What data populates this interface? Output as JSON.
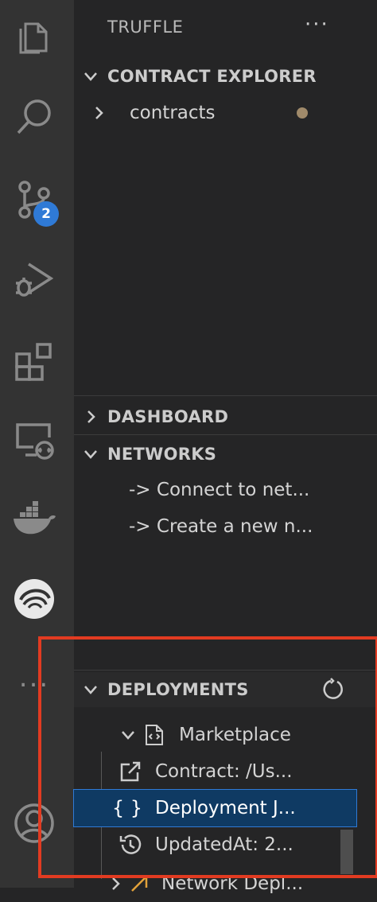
{
  "activity_bar": {
    "icons": [
      "explorer-icon",
      "search-icon",
      "source-control-icon",
      "run-debug-icon",
      "extensions-icon",
      "remote-explorer-icon",
      "docker-icon",
      "truffle-icon",
      "more-icon",
      "account-icon"
    ],
    "source_control_badge": "2",
    "more_label": "..."
  },
  "sidebar": {
    "title": "TRUFFLE",
    "more_label": "···",
    "contract_explorer": {
      "label": "CONTRACT EXPLORER",
      "items": [
        {
          "label": "contracts"
        }
      ]
    },
    "dashboard": {
      "label": "DASHBOARD"
    },
    "networks": {
      "label": "NETWORKS",
      "items": [
        {
          "label": "-> Connect to net..."
        },
        {
          "label": "-> Create a new n..."
        }
      ]
    },
    "deployments": {
      "label": "DEPLOYMENTS",
      "tree": {
        "label": "Marketplace",
        "children": [
          {
            "label": "Contract: /Us...",
            "icon": "link-external-icon"
          },
          {
            "label": "Deployment J...",
            "icon": "json-braces-icon",
            "selected": true
          },
          {
            "label": "UpdatedAt: 2...",
            "icon": "history-icon"
          }
        ],
        "next": {
          "label": "Network Depl..."
        }
      }
    }
  },
  "colors": {
    "activity_bg": "#333333",
    "sidebar_bg": "#252526",
    "badge": "#2f7ad6",
    "selection": "#0f3a63",
    "highlight_box": "#e23b21",
    "contracts_text": "#e2c08d"
  }
}
